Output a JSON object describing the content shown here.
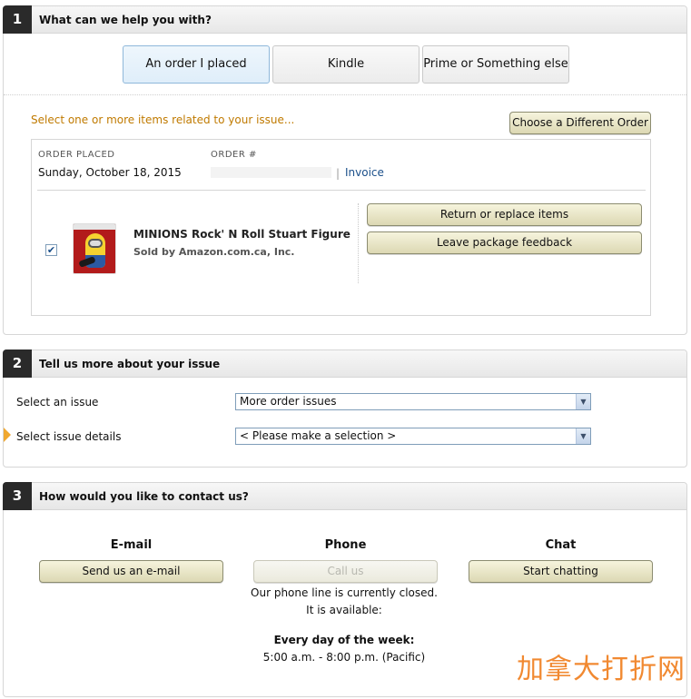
{
  "step1": {
    "number": "1",
    "title": "What can we help you with?",
    "tabs": [
      {
        "label": "An order I placed",
        "selected": true
      },
      {
        "label": "Kindle",
        "selected": false
      },
      {
        "label": "Prime or Something else",
        "selected": false
      }
    ],
    "hint": "Select one or more items related to your issue...",
    "choose_order_button": "Choose a Different Order",
    "order": {
      "placed_label": "ORDER PLACED",
      "placed_date": "Sunday, October 18, 2015",
      "number_label": "ORDER #",
      "invoice_link": "Invoice",
      "item": {
        "checked": true,
        "checkmark": "✔",
        "name": "MINIONS Rock' N Roll Stuart Figure",
        "seller": "Sold by Amazon.com.ca, Inc."
      },
      "return_button": "Return or replace items",
      "feedback_button": "Leave package feedback"
    }
  },
  "step2": {
    "number": "2",
    "title": "Tell us more about your issue",
    "issue_label": "Select an issue",
    "issue_value": "More order issues",
    "details_label": "Select issue details",
    "details_value": "< Please make a selection >",
    "arrow_glyph": "▼"
  },
  "step3": {
    "number": "3",
    "title": "How would you like to contact us?",
    "email": {
      "title": "E-mail",
      "button": "Send us an e-mail"
    },
    "phone": {
      "title": "Phone",
      "button": "Call us",
      "disabled": true,
      "note": "Our phone line is currently closed. It is available:",
      "hours_title": "Every day of the week:",
      "hours": "5:00 a.m. - 8:00 p.m. (Pacific)"
    },
    "chat": {
      "title": "Chat",
      "button": "Start chatting"
    }
  },
  "watermark": "加拿大打折网",
  "colors": {
    "accent_orange": "#c07a00",
    "link_blue": "#1a4f8a",
    "button_face": "#e9e6c6"
  }
}
